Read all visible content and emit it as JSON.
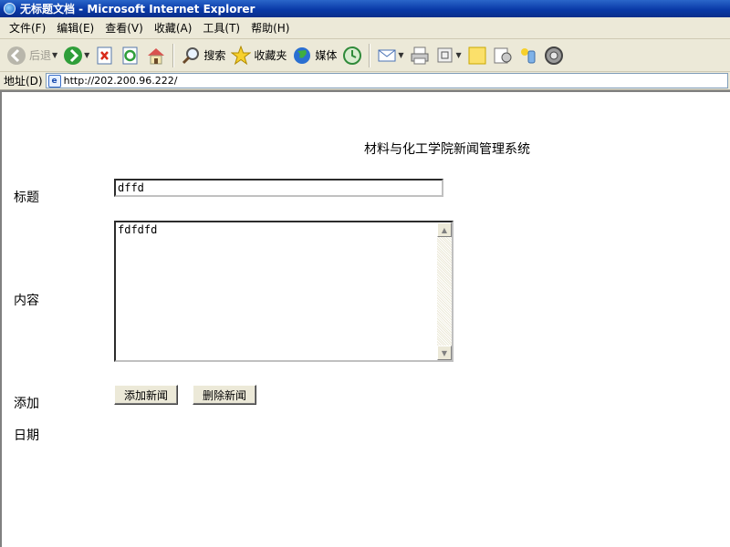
{
  "window": {
    "title": "无标题文档 - Microsoft Internet Explorer"
  },
  "menu": {
    "items": [
      "文件(F)",
      "编辑(E)",
      "查看(V)",
      "收藏(A)",
      "工具(T)",
      "帮助(H)"
    ]
  },
  "toolbar": {
    "back": "后退",
    "search": "搜索",
    "favorites": "收藏夹",
    "media": "媒体"
  },
  "address": {
    "label": "地址(D)",
    "url": "http://202.200.96.222/"
  },
  "page": {
    "title": "材料与化工学院新闻管理系统",
    "title_label": "标题",
    "title_value": "dffd",
    "content_label": "内容",
    "content_value": "fdfdfd",
    "add_label": "添加",
    "date_label": "日期",
    "add_button": "添加新闻",
    "delete_button": "删除新闻"
  }
}
